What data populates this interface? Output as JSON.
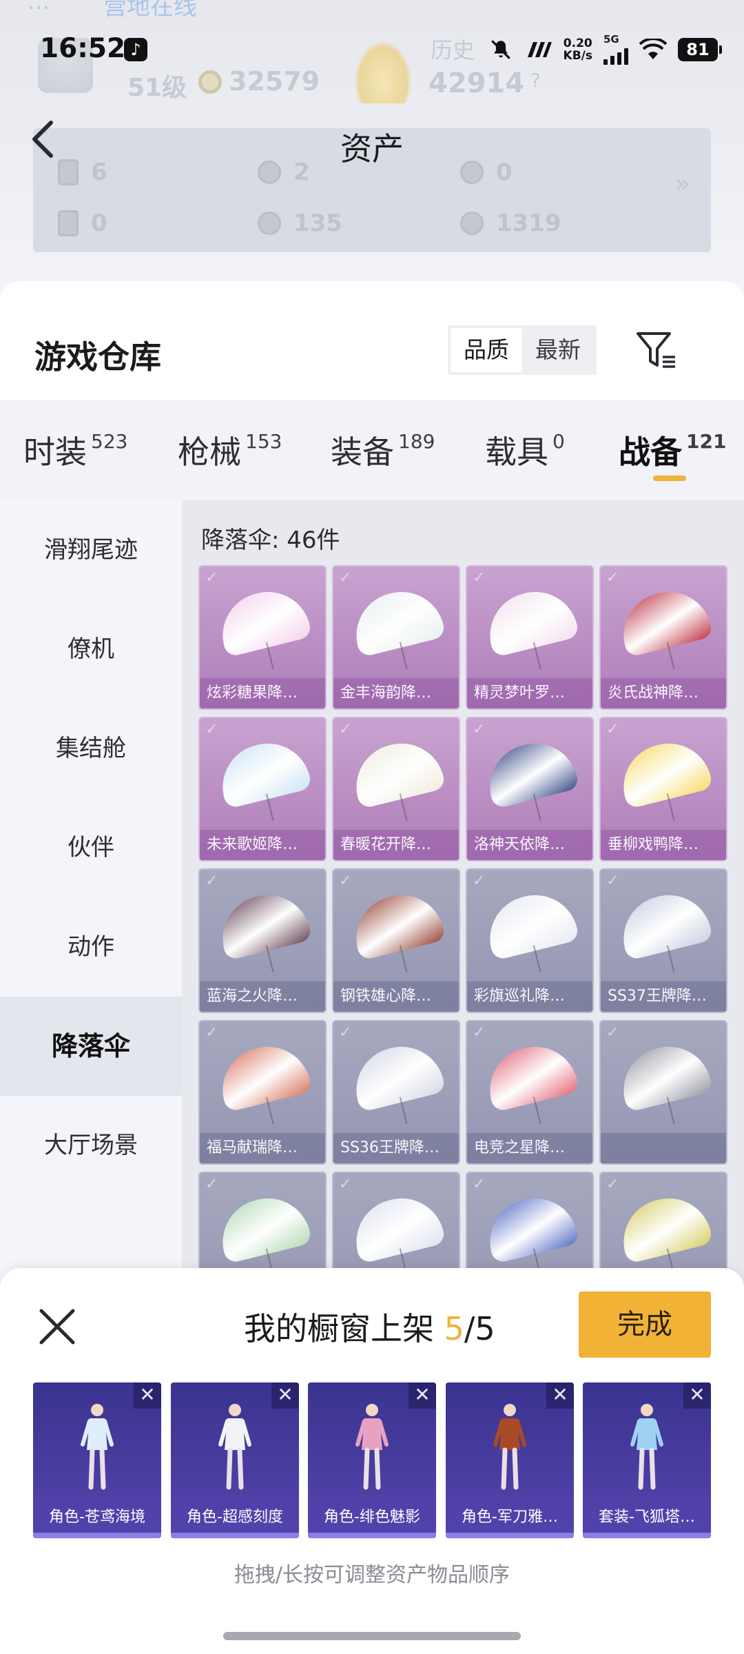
{
  "status_bar": {
    "time": "16:52",
    "net_speed_value": "0.20",
    "net_speed_unit": "KB/s",
    "network": "5G",
    "battery": "81"
  },
  "background_header": {
    "prev_text": "...",
    "link_text": "营地在线",
    "level": "51级",
    "coins": "32579",
    "history_label": "历史",
    "history_value": "42914",
    "question": "?",
    "assets": [
      {
        "value": "6"
      },
      {
        "value": "2"
      },
      {
        "value": "0"
      },
      {
        "value": "0"
      },
      {
        "value": "135"
      },
      {
        "value": "1319"
      }
    ],
    "more": "»"
  },
  "page": {
    "title": "资产"
  },
  "warehouse": {
    "title": "游戏仓库",
    "sort_options": [
      "品质",
      "最新"
    ],
    "active_sort": "品质"
  },
  "categories": [
    {
      "label": "时装",
      "count": "523"
    },
    {
      "label": "枪械",
      "count": "153"
    },
    {
      "label": "装备",
      "count": "189"
    },
    {
      "label": "载具",
      "count": "0"
    },
    {
      "label": "战备",
      "count": "121"
    }
  ],
  "sidebar": [
    {
      "label": "滑翔尾迹"
    },
    {
      "label": "僚机"
    },
    {
      "label": "集结舱"
    },
    {
      "label": "伙伴"
    },
    {
      "label": "动作"
    },
    {
      "label": "降落伞"
    },
    {
      "label": "大厅场景"
    }
  ],
  "grid": {
    "title": "降落伞: 46件",
    "items": [
      {
        "label": "炫彩糖果降…",
        "tier": "purple",
        "color": "#f5d2ee"
      },
      {
        "label": "金丰海韵降…",
        "tier": "purple",
        "color": "#e8f0f0"
      },
      {
        "label": "精灵梦叶罗…",
        "tier": "purple",
        "color": "#f3e2ee"
      },
      {
        "label": "炎氏战神降…",
        "tier": "purple",
        "color": "#c0394a"
      },
      {
        "label": "未来歌姬降…",
        "tier": "purple",
        "color": "#cfe4f5"
      },
      {
        "label": "春暖花开降…",
        "tier": "purple",
        "color": "#f1ece0"
      },
      {
        "label": "洛神天依降…",
        "tier": "purple",
        "color": "#3e4f8a"
      },
      {
        "label": "垂柳戏鸭降…",
        "tier": "purple",
        "color": "#f6dc6a"
      },
      {
        "label": "蓝海之火降…",
        "tier": "gray",
        "color": "#6a4a5a"
      },
      {
        "label": "钢铁雄心降…",
        "tier": "gray",
        "color": "#9a4a3c"
      },
      {
        "label": "彩旗巡礼降…",
        "tier": "gray",
        "color": "#e8eaf3"
      },
      {
        "label": "SS37王牌降…",
        "tier": "gray",
        "color": "#c9cfe3"
      },
      {
        "label": "福马献瑞降…",
        "tier": "gray",
        "color": "#d97a66"
      },
      {
        "label": "SS36王牌降…",
        "tier": "gray",
        "color": "#d6d8e6"
      },
      {
        "label": "电竞之星降…",
        "tier": "gray",
        "color": "#e46a7a"
      },
      {
        "label": "",
        "tier": "gray",
        "color": "#9a9aa6"
      },
      {
        "label": "",
        "tier": "gray",
        "color": "#b5dbb6"
      },
      {
        "label": "",
        "tier": "gray",
        "color": "#dfe3ef"
      },
      {
        "label": "",
        "tier": "gray",
        "color": "#5a6fc6"
      },
      {
        "label": "",
        "tier": "gray",
        "color": "#d8cf6a"
      }
    ]
  },
  "showcase": {
    "title": "我的橱窗上架",
    "count_current": "5",
    "count_sep": "/",
    "count_total": "5",
    "done_label": "完成",
    "remove_glyph": "✕",
    "items": [
      {
        "label": "角色-苍鸢海境",
        "color": "#dfeefb"
      },
      {
        "label": "角色-超感刻度",
        "color": "#f3f3f7"
      },
      {
        "label": "角色-绯色魅影",
        "color": "#e7a2c2"
      },
      {
        "label": "角色-军刀雅…",
        "color": "#a94a26"
      },
      {
        "label": "套装-飞狐塔…",
        "color": "#9fd2f2"
      }
    ],
    "hint": "拖拽/长按可调整资产物品顺序"
  }
}
